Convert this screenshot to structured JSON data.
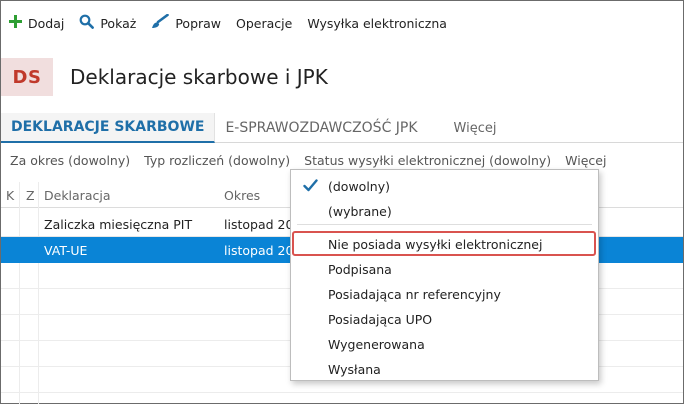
{
  "toolbar": {
    "add_label": "Dodaj",
    "show_label": "Pokaż",
    "edit_label": "Popraw",
    "operations_label": "Operacje",
    "electronic_send_label": "Wysyłka elektroniczna",
    "icons": {
      "add": "plus-icon",
      "show": "magnifier-icon",
      "edit": "brush-icon"
    },
    "colors": {
      "add_icon": "#2e9e33",
      "show_icon": "#1f6fa8",
      "edit_icon": "#1f6fa8"
    }
  },
  "header": {
    "badge": "DS",
    "title": "Deklaracje skarbowe i JPK"
  },
  "tabs": [
    {
      "label": "DEKLARACJE SKARBOWE",
      "active": true
    },
    {
      "label": "E-SPRAWOZDAWCZOŚĆ JPK",
      "active": false
    },
    {
      "label": "Więcej",
      "active": false
    }
  ],
  "filters": {
    "period": "Za okres (dowolny)",
    "settlement_type": "Typ rozliczeń (dowolny)",
    "send_status": "Status wysyłki elektronicznej (dowolny)",
    "more": "Więcej"
  },
  "grid": {
    "columns": {
      "k": "K",
      "z": "Z",
      "declaration": "Deklaracja",
      "period": "Okres"
    },
    "rows": [
      {
        "declaration": "Zaliczka miesięczna PIT",
        "period": "listopad 20",
        "selected": false
      },
      {
        "declaration": "VAT-UE",
        "period": "listopad 20",
        "selected": true
      }
    ]
  },
  "dropdown": {
    "options": [
      {
        "label": "(dowolny)",
        "checked": true
      },
      {
        "label": "(wybrane)",
        "checked": false
      },
      {
        "label": "Nie posiada wysyłki elektronicznej",
        "highlighted": true
      },
      {
        "label": "Podpisana"
      },
      {
        "label": "Posiadająca nr referencyjny"
      },
      {
        "label": "Posiadająca UPO"
      },
      {
        "label": "Wygenerowana"
      },
      {
        "label": "Wysłana"
      }
    ]
  },
  "colors": {
    "accent": "#1f6fa8",
    "selection": "#0a84d6",
    "badge_bg": "#f1dede",
    "badge_fg": "#c0392b",
    "highlight_border": "#d9534f"
  }
}
